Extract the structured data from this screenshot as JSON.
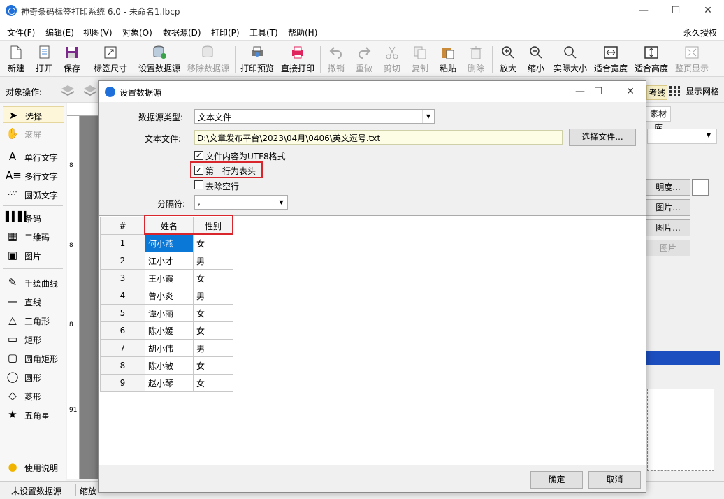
{
  "window": {
    "title": "神奇条码标签打印系统 6.0 - 未命名1.lbcp",
    "minimize": "—",
    "maximize": "☐",
    "close": "✕"
  },
  "menu": [
    "文件(F)",
    "编辑(E)",
    "视图(V)",
    "对象(O)",
    "数据源(D)",
    "打印(P)",
    "工具(T)",
    "帮助(H)"
  ],
  "license": "永久授权",
  "toolbar": [
    "新建",
    "打开",
    "保存",
    "标签尺寸",
    "设置数据源",
    "移除数据源",
    "打印预览",
    "直接打印",
    "撤销",
    "重做",
    "剪切",
    "复制",
    "粘贴",
    "删除",
    "放大",
    "缩小",
    "实际大小",
    "适合宽度",
    "适合高度",
    "整页显示"
  ],
  "objbar": {
    "label": "对象操作:",
    "guides": "考线",
    "show_grid": "显示网格"
  },
  "tools": [
    "选择",
    "滚屏",
    "单行文字",
    "多行文字",
    "圆弧文字",
    "条码",
    "二维码",
    "图片",
    "手绘曲线",
    "直线",
    "三角形",
    "矩形",
    "圆角矩形",
    "圆形",
    "菱形",
    "五角星",
    "使用说明"
  ],
  "ruler_marks": [
    "8",
    "8",
    "8",
    "91"
  ],
  "right_panel": {
    "tab": "素材库",
    "b1": "明度...",
    "b2": "图片...",
    "b3": "图片...",
    "b4": "图片"
  },
  "status": {
    "datasource": "未设置数据源",
    "zoom": "缩放"
  },
  "dialog": {
    "title": "设置数据源",
    "source_type_label": "数据源类型:",
    "source_type_value": "文本文件",
    "file_label": "文本文件:",
    "file_path": "D:\\文章发布平台\\2023\\04月\\0406\\英文逗号.txt",
    "choose_file": "选择文件...",
    "opt_utf8": "文件内容为UTF8格式",
    "opt_header": "第一行为表头",
    "opt_skip_empty": "去除空行",
    "separator_label": "分隔符:",
    "separator_value": ",",
    "ok": "确定",
    "cancel": "取消",
    "grid": {
      "headers": [
        "#",
        "姓名",
        "性别"
      ],
      "rows": [
        [
          "1",
          "何小燕",
          "女"
        ],
        [
          "2",
          "江小才",
          "男"
        ],
        [
          "3",
          "王小霞",
          "女"
        ],
        [
          "4",
          "曾小炎",
          "男"
        ],
        [
          "5",
          "谭小丽",
          "女"
        ],
        [
          "6",
          "陈小媛",
          "女"
        ],
        [
          "7",
          "胡小伟",
          "男"
        ],
        [
          "8",
          "陈小敏",
          "女"
        ],
        [
          "9",
          "赵小琴",
          "女"
        ]
      ]
    }
  },
  "colors": {
    "accent": "#0a78d7",
    "highlight_box": "#d9262c",
    "file_input_bg": "#fdfde6"
  }
}
